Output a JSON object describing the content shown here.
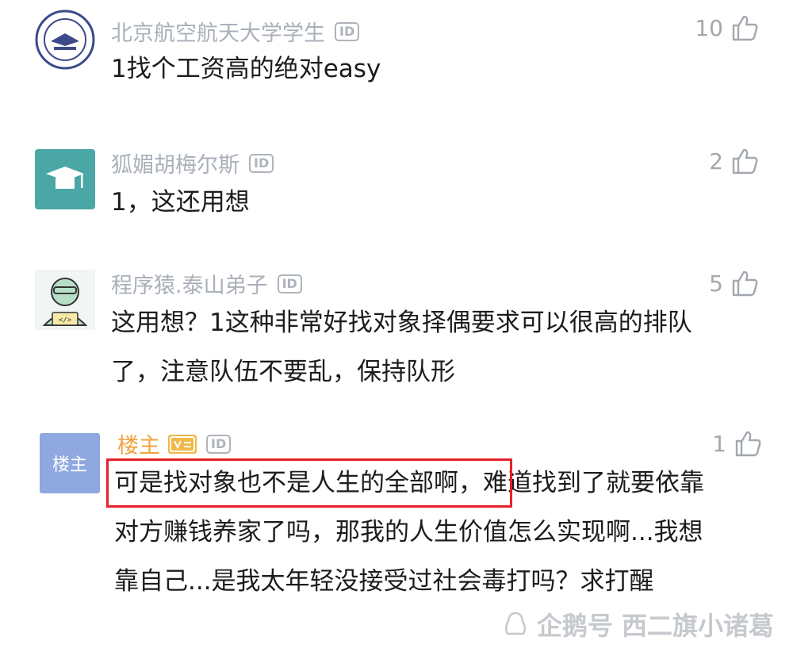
{
  "comments": [
    {
      "username": "北京航空航天大学学生",
      "id_badge": "ID",
      "text": "1找个工资高的绝对easy",
      "likes": "10"
    },
    {
      "username": "狐媚胡梅尔斯",
      "id_badge": "ID",
      "text": "1，这还用想",
      "likes": "2"
    },
    {
      "username": "程序猿.泰山弟子",
      "id_badge": "ID",
      "text": "这用想？1这种非常好找对象择偶要求可以很高的排队了，注意队伍不要乱，保持队形",
      "likes": "5"
    },
    {
      "username": "楼主",
      "avatar_label": "楼主",
      "id_badge": "ID",
      "text": "可是找对象也不是人生的全部啊，难道找到了就要依靠对方赚钱养家了吗，那我的人生价值怎么实现啊...我想靠自己...是我太年轻没接受过社会毒打吗？求打醒",
      "likes": "1"
    }
  ],
  "watermark": "企鹅号 西二旗小诸葛",
  "colors": {
    "username": "#aab0b8",
    "host_name": "#f0a23c",
    "highlight_border": "#e8202a",
    "avatar_teal": "#4aa7a5",
    "host_avatar": "#8fa8e0"
  }
}
